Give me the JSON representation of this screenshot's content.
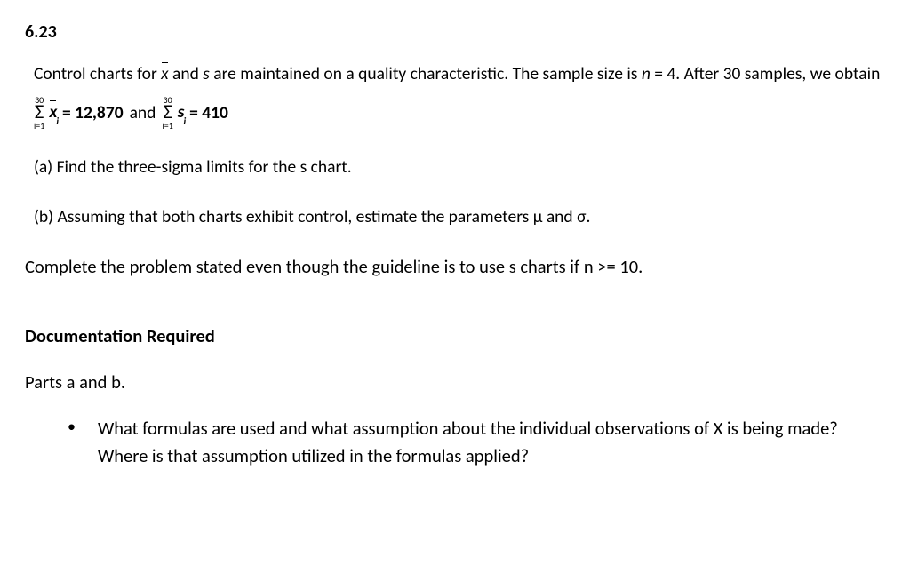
{
  "problem_number": "6.23",
  "intro": {
    "pre": "Control charts for ",
    "xbar": "x",
    "mid1": " and ",
    "s": "s",
    "mid2": "  are maintained on a quality characteristic.  The sample size is ",
    "n": "n",
    "eq": " = 4.  After 30 samples, we obtain"
  },
  "sum": {
    "upper": "30",
    "lower": "i=1",
    "sigma": "Σ",
    "xvar": "x",
    "sub": "i",
    "eq1": "= 12,870",
    "and": "and",
    "svar": "s",
    "eq2": "= 410"
  },
  "part_a": "(a)  Find the three-sigma limits for the s chart.",
  "part_b": "(b)  Assuming that both charts exhibit control, estimate the parameters μ and σ.",
  "guideline": "Complete the problem stated even though the guideline is to use s charts if n >= 10.",
  "doc_heading": "Documentation Required",
  "parts_label": "Parts a and b.",
  "bullet_text": "What formulas are used and what assumption about the individual observations of X is being made? Where is that assumption utilized in the formulas applied?"
}
